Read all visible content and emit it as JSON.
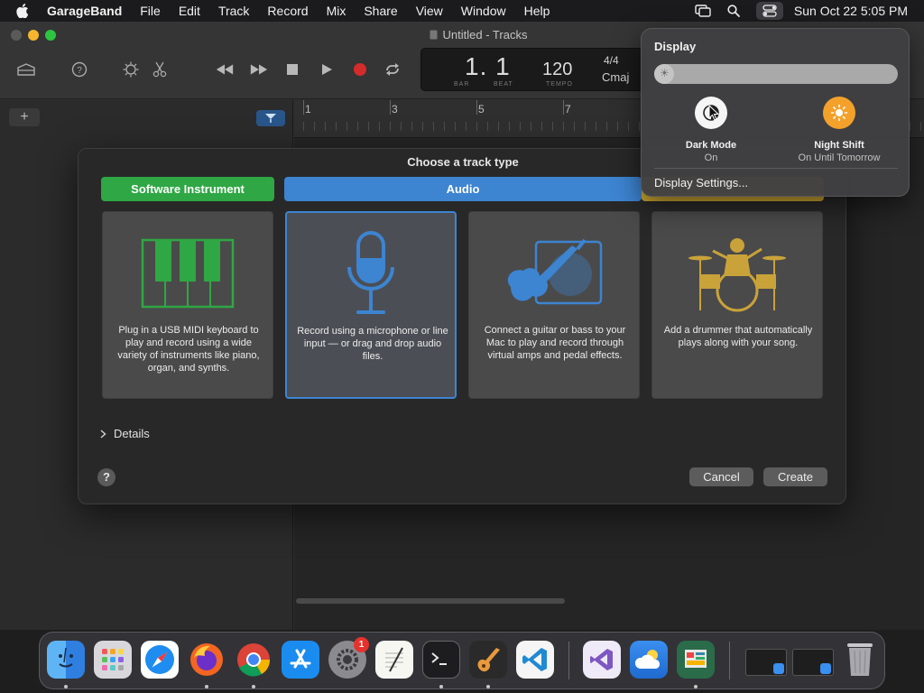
{
  "menubar": {
    "app_name": "GarageBand",
    "menus": [
      "File",
      "Edit",
      "Track",
      "Record",
      "Mix",
      "Share",
      "View",
      "Window",
      "Help"
    ],
    "clock": "Sun Oct 22  5:05 PM"
  },
  "window": {
    "title": "Untitled - Tracks",
    "lcd": {
      "position": "1. 1",
      "bar_label": "BAR",
      "beat_label": "BEAT",
      "tempo": "120",
      "tempo_label": "TEMPO",
      "time_signature": "4/4",
      "key": "Cmaj"
    },
    "ruler_marks": [
      "1",
      "3",
      "5",
      "7"
    ]
  },
  "dialog": {
    "title": "Choose a track type",
    "tabs": {
      "software_instrument": "Software Instrument",
      "audio": "Audio"
    },
    "cards": [
      {
        "desc": "Plug in a USB MIDI keyboard to play and record using a wide variety of instruments like piano, organ, and synths."
      },
      {
        "desc": "Record using a microphone or line input — or drag and drop audio files."
      },
      {
        "desc": "Connect a guitar or bass to your Mac to play and record through virtual amps and pedal effects."
      },
      {
        "desc": "Add a drummer that automatically plays along with your song."
      }
    ],
    "details_label": "Details",
    "help_label": "?",
    "cancel_label": "Cancel",
    "create_label": "Create"
  },
  "control_center": {
    "header": "Display",
    "brightness_level": 0.06,
    "dark_mode": {
      "title": "Dark Mode",
      "status": "On"
    },
    "night_shift": {
      "title": "Night Shift",
      "status": "On Until Tomorrow"
    },
    "settings_label": "Display Settings..."
  },
  "dock": {
    "apps": [
      "finder-icon",
      "launchpad-icon",
      "safari-icon",
      "firefox-icon",
      "chrome-icon",
      "app-store-icon",
      "system-settings-icon",
      "textedit-icon",
      "terminal-icon",
      "garageband-icon",
      "vscode-icon",
      "visual-studio-icon",
      "weather-icon",
      "activity-icon",
      "window-thumb-1",
      "window-thumb-2",
      "trash-icon"
    ],
    "settings_badge": "1"
  },
  "colors": {
    "software_instrument": "#2fa744",
    "audio": "#3d84d1",
    "drummer": "#d1a931",
    "night_shift": "#f3a12b"
  }
}
